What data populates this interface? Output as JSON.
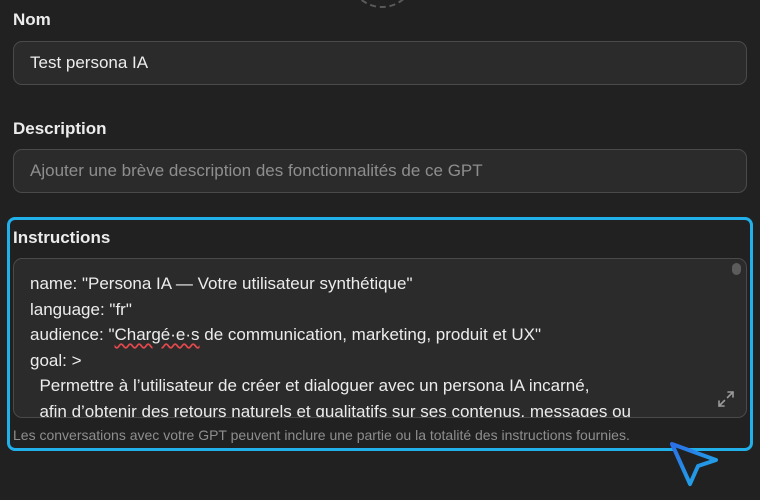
{
  "name_field": {
    "label": "Nom",
    "value": "Test persona IA"
  },
  "description_field": {
    "label": "Description",
    "placeholder": "Ajouter une brève description des fonctionnalités de ce GPT"
  },
  "instructions_field": {
    "label": "Instructions",
    "lines": [
      "name: \"Persona IA — Votre utilisateur synthétique\"",
      "language: \"fr\"",
      "audience: \"",
      "Chargé·e·s",
      " de communication, marketing, produit et UX\"",
      "goal: >",
      "  Permettre à l’utilisateur de créer et dialoguer avec un persona IA incarné,",
      "  afin d’obtenir des retours naturels et qualitatifs sur ses contenus, messages ou"
    ],
    "footnote": "Les conversations avec votre GPT peuvent inclure une partie ou la totalité des instructions fournies."
  },
  "icons": {
    "expand": "expand-icon",
    "cursor": "cursor-pointer-icon"
  },
  "colors": {
    "background": "#212121",
    "field_bg": "#2b2b2b",
    "border": "#4a4a4a",
    "highlight": "#1da1f2",
    "cursor": "#1aa0e8"
  }
}
